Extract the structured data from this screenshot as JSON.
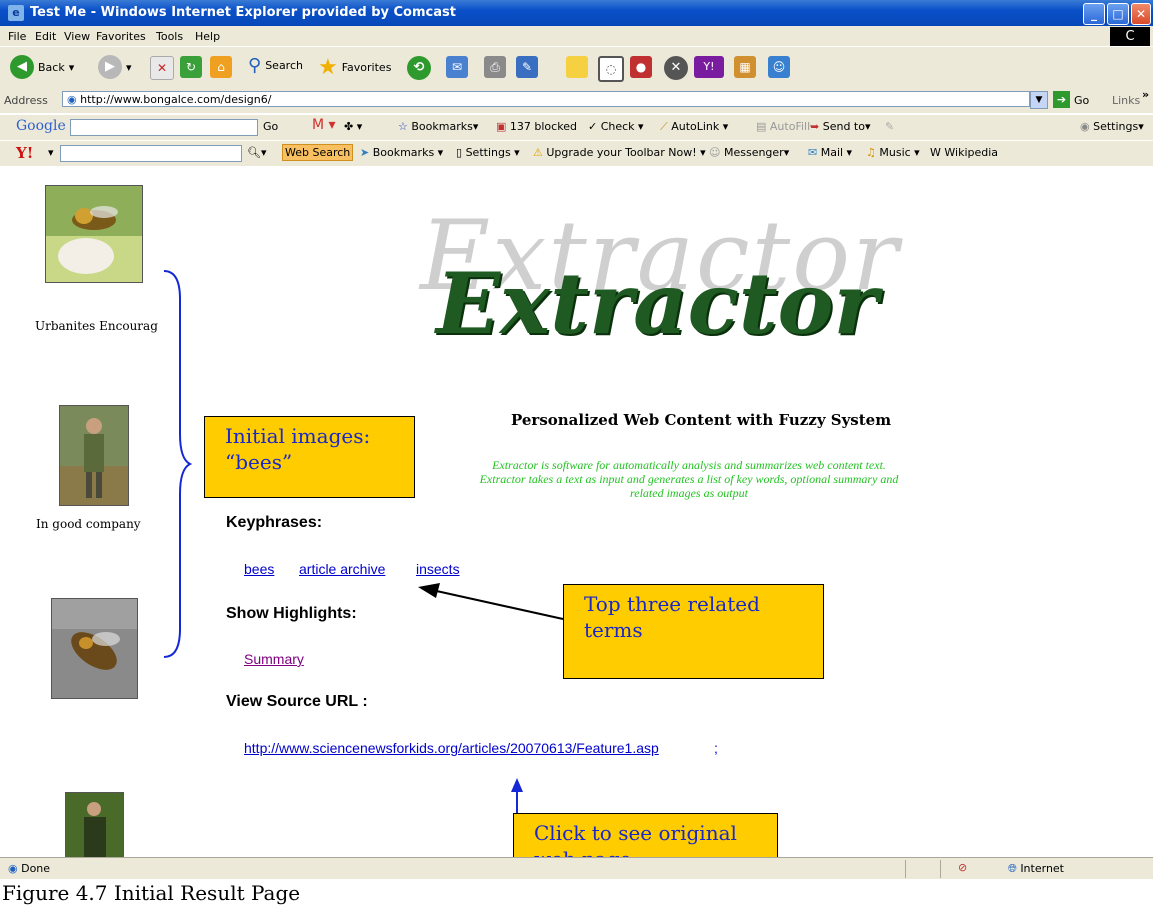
{
  "window": {
    "title": "Test Me - Windows Internet Explorer provided by Comcast",
    "brand_badge": "C"
  },
  "menu": [
    "File",
    "Edit",
    "View",
    "Favorites",
    "Tools",
    "Help"
  ],
  "toolbar": {
    "back_label": "Back",
    "search_label": "Search",
    "favorites_label": "Favorites"
  },
  "address": {
    "label": "Address",
    "url": "http://www.bongalce.com/design6/",
    "go_label": "Go",
    "links_label": "Links"
  },
  "google_toolbar": {
    "logo": "Google",
    "go_label": "Go",
    "bookmarks_label": "Bookmarks",
    "blocked_label": "137 blocked",
    "check_label": "Check",
    "autolink_label": "AutoLink",
    "autofill_label": "AutoFill",
    "sendto_label": "Send to",
    "settings_label": "Settings"
  },
  "yahoo_toolbar": {
    "logo": "Y!",
    "web_search_label": "Web Search",
    "bookmarks_label": "Bookmarks",
    "settings_label": "Settings",
    "upgrade_label": "Upgrade your Toolbar Now!",
    "messenger_label": "Messenger",
    "mail_label": "Mail",
    "music_label": "Music",
    "wikipedia_label": "Wikipedia"
  },
  "page": {
    "logo_text": "Extractor",
    "subtitle": "Personalized Web Content with Fuzzy System",
    "description": [
      "Extractor is software for automatically analysis and summarizes web content text.",
      "Extractor takes a text as input and generates a list of key words, optional summary and",
      "related images as output"
    ],
    "sidebar_captions": [
      "Urbanites Encourag",
      "In good company w"
    ],
    "keyphrases_heading": "Keyphrases:",
    "keyphrases": [
      "bees",
      "article archive",
      "insects"
    ],
    "highlights_heading": "Show Highlights:",
    "summary_link": "Summary",
    "source_heading": "View Source URL :",
    "source_url": "http://www.sciencenewsforkids.org/articles/20070613/Feature1.asp",
    "source_url_suffix": ";"
  },
  "callouts": {
    "initial_images": [
      "Initial images:",
      "“bees”"
    ],
    "top_terms": [
      "Top three related",
      "terms"
    ],
    "original_page": [
      "Click to see original",
      "web page"
    ]
  },
  "status": {
    "left": "Done",
    "zone": "Internet"
  },
  "figure_caption": "Figure 4.7 Initial Result Page",
  "colors": {
    "callout_fill": "#ffcc00",
    "callout_text": "#1a28c8",
    "link": "#0000cc",
    "description_green": "#22c322",
    "logo_green": "#1e5a22"
  }
}
